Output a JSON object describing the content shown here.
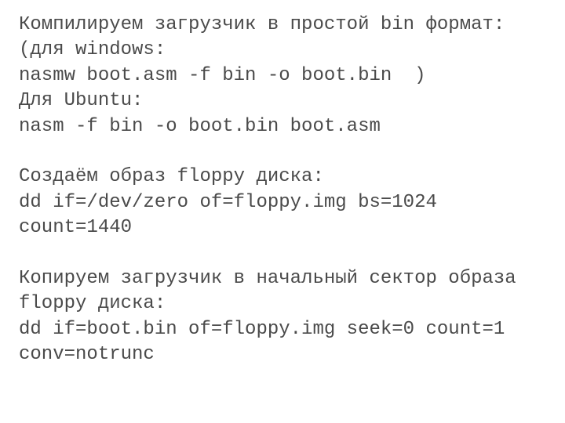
{
  "lines": [
    "Компилируем загрузчик в простой bin формат:",
    "(для windows:",
    "nasmw boot.asm -f bin -o boot.bin  )",
    "Для Ubuntu:",
    "nasm -f bin -o boot.bin boot.asm",
    "",
    "Создаём образ floppy диска:",
    "dd if=/dev/zero of=floppy.img bs=1024 count=1440",
    "",
    "Копируем загрузчик в начальный сектор образа floppy диска:",
    "dd if=boot.bin of=floppy.img seek=0 count=1 conv=notrunc"
  ]
}
